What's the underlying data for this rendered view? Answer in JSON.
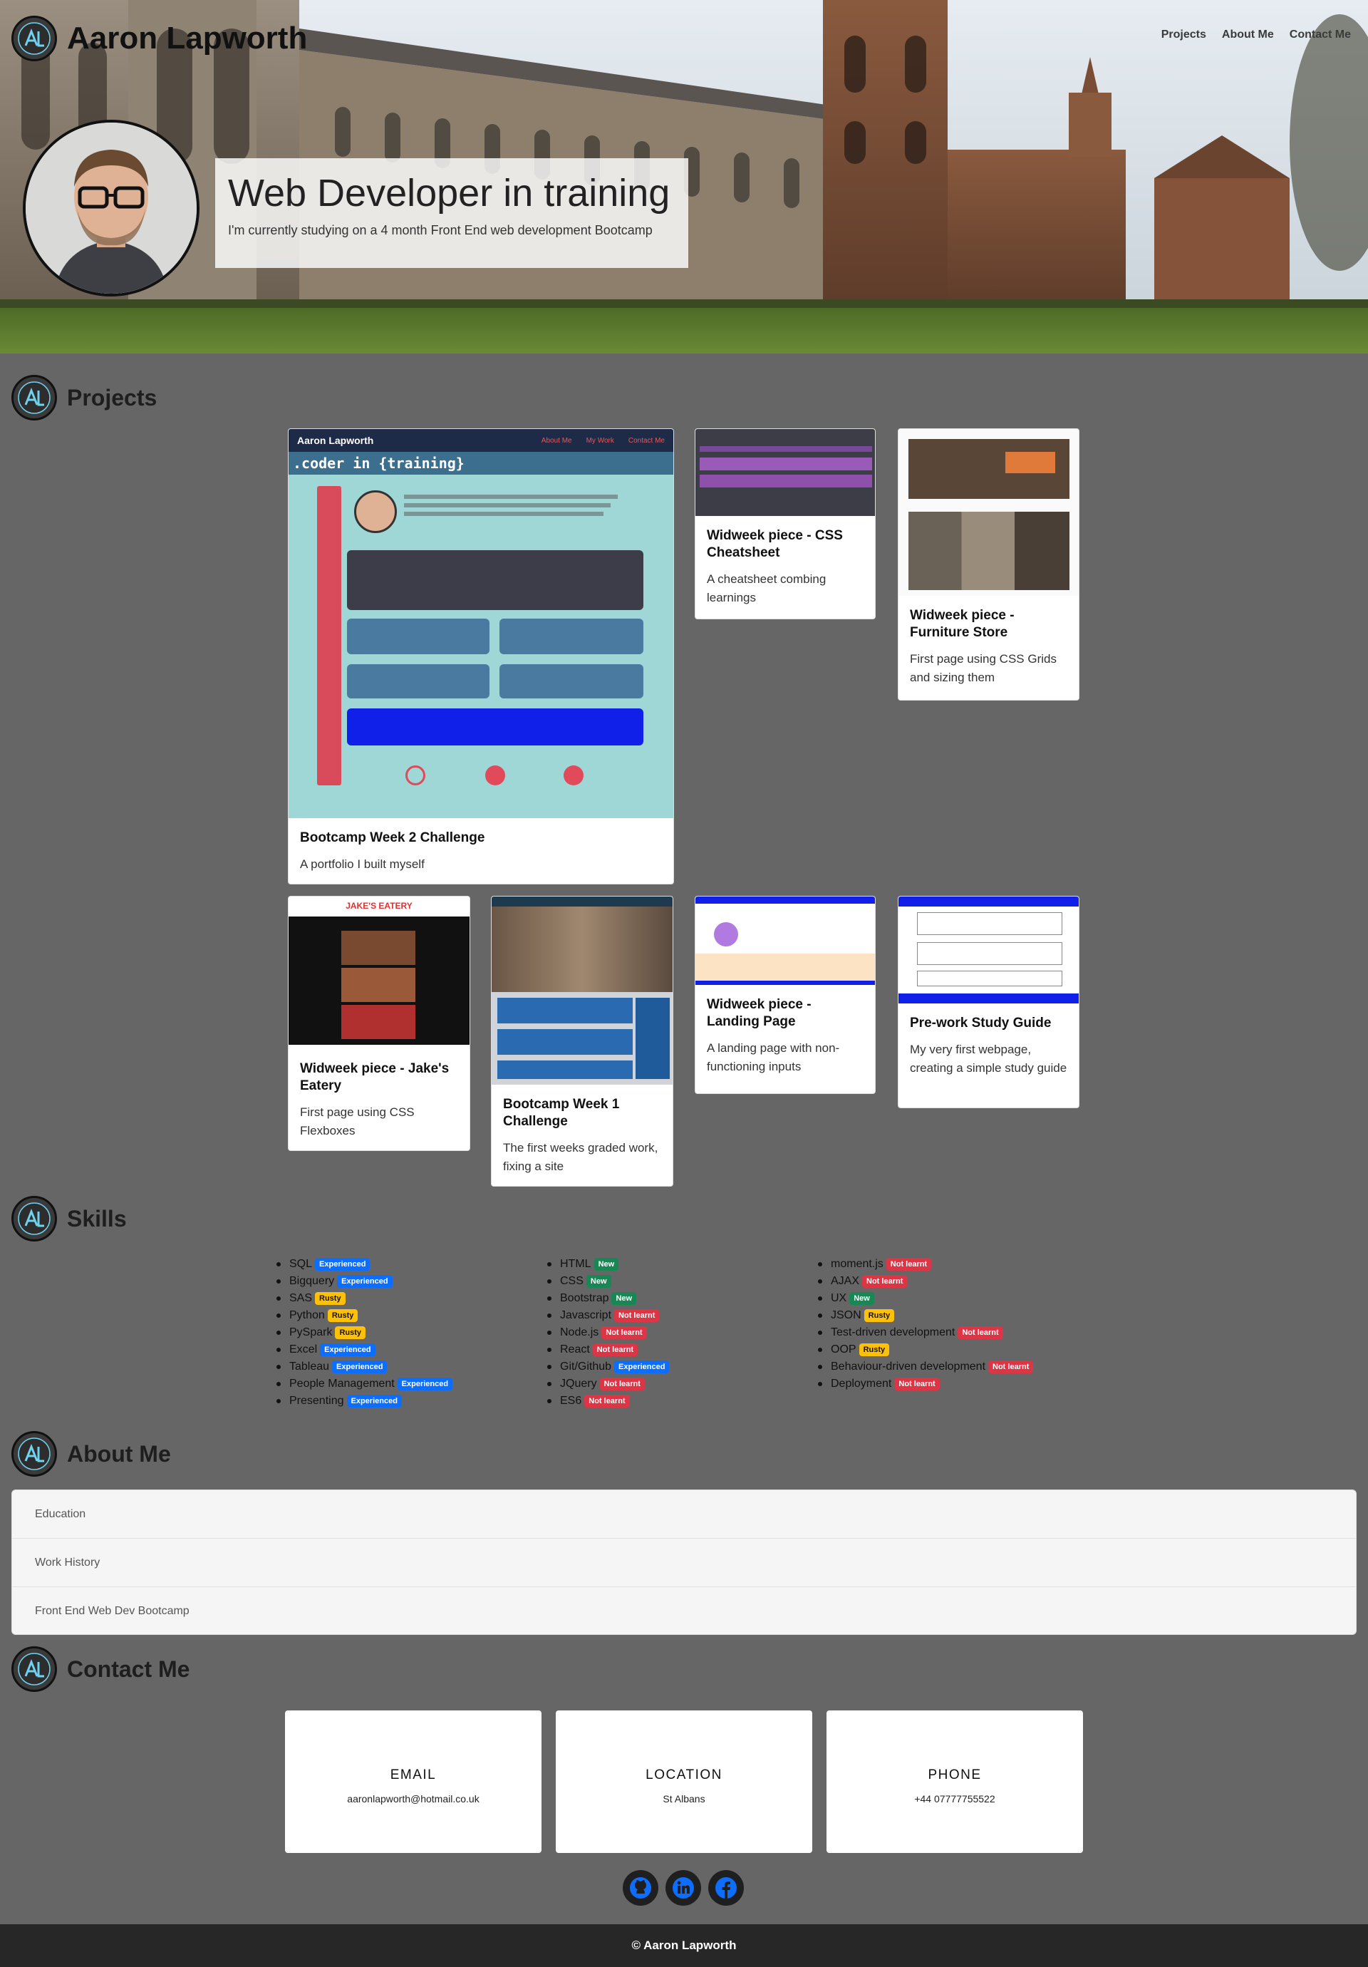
{
  "header": {
    "brand_name": "Aaron Lapworth",
    "nav": [
      "Projects",
      "About Me",
      "Contact Me"
    ],
    "hero_title": "Web Developer in training",
    "hero_subtitle": "I'm currently studying on a 4 month Front End web development Bootcamp"
  },
  "sections": {
    "projects": "Projects",
    "skills": "Skills",
    "about": "About Me",
    "contact": "Contact Me"
  },
  "projects": [
    {
      "title": "Bootcamp Week 2 Challenge",
      "text": "A portfolio I built myself",
      "thumb_heading": "Aaron Lapworth",
      "thumb_tagline": ".coder in {training}",
      "thumb_nav": [
        "About Me",
        "My Work",
        "Contact Me"
      ]
    },
    {
      "title": "Widweek piece - CSS Cheatsheet",
      "text": "A cheatsheet combing learnings"
    },
    {
      "title": "Widweek piece - Furniture Store",
      "text": "First page using CSS Grids and sizing them"
    },
    {
      "title": "Widweek piece - Jake's Eatery",
      "text": "First page using CSS Flexboxes",
      "thumb_heading": "JAKE'S EATERY"
    },
    {
      "title": "Bootcamp Week 1 Challenge",
      "text": "The first weeks graded work, fixing a site"
    },
    {
      "title": "Widweek piece - Landing Page",
      "text": "A landing page with non-functioning inputs"
    },
    {
      "title": "Pre-work Study Guide",
      "text": "My very first webpage, creating a simple study guide"
    }
  ],
  "skills": {
    "col1": [
      {
        "name": "SQL",
        "level": "Experienced"
      },
      {
        "name": "Bigquery",
        "level": "Experienced"
      },
      {
        "name": "SAS",
        "level": "Rusty"
      },
      {
        "name": "Python",
        "level": "Rusty"
      },
      {
        "name": "PySpark",
        "level": "Rusty"
      },
      {
        "name": "Excel",
        "level": "Experienced"
      },
      {
        "name": "Tableau",
        "level": "Experienced"
      },
      {
        "name": "People Management",
        "level": "Experienced"
      },
      {
        "name": "Presenting",
        "level": "Experienced"
      }
    ],
    "col2": [
      {
        "name": "HTML",
        "level": "New"
      },
      {
        "name": "CSS",
        "level": "New"
      },
      {
        "name": "Bootstrap",
        "level": "New"
      },
      {
        "name": "Javascript",
        "level": "Not learnt"
      },
      {
        "name": "Node.js",
        "level": "Not learnt"
      },
      {
        "name": "React",
        "level": "Not learnt"
      },
      {
        "name": "Git/Github",
        "level": "Experienced"
      },
      {
        "name": "JQuery",
        "level": "Not learnt"
      },
      {
        "name": "ES6",
        "level": "Not learnt"
      }
    ],
    "col3": [
      {
        "name": "moment.js",
        "level": "Not learnt"
      },
      {
        "name": "AJAX",
        "level": "Not learnt"
      },
      {
        "name": "UX",
        "level": "New"
      },
      {
        "name": "JSON",
        "level": "Rusty"
      },
      {
        "name": "Test-driven development",
        "level": "Not learnt"
      },
      {
        "name": "OOP",
        "level": "Rusty"
      },
      {
        "name": "Behaviour-driven development",
        "level": "Not learnt"
      },
      {
        "name": "Deployment",
        "level": "Not learnt"
      }
    ]
  },
  "about": [
    "Education",
    "Work History",
    "Front End Web Dev Bootcamp"
  ],
  "contact": [
    {
      "label": "EMAIL",
      "value": "aaronlapworth@hotmail.co.uk"
    },
    {
      "label": "LOCATION",
      "value": "St Albans"
    },
    {
      "label": "PHONE",
      "value": "+44 07777755522"
    }
  ],
  "socials": [
    "github-icon",
    "linkedin-icon",
    "facebook-icon"
  ],
  "footer": "© Aaron Lapworth",
  "colors": {
    "page_bg": "#666666",
    "experienced": "#0d6efd",
    "new": "#198754",
    "rusty": "#ffc107",
    "not_learnt": "#dc3545",
    "footer_bg": "#272727"
  }
}
